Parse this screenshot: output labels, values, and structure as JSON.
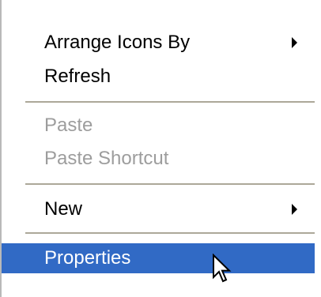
{
  "menu": {
    "items": [
      {
        "label": "Arrange Icons By",
        "has_submenu": true
      },
      {
        "label": "Refresh",
        "has_submenu": false
      },
      {
        "label": "Paste",
        "disabled": true
      },
      {
        "label": "Paste Shortcut",
        "disabled": true
      },
      {
        "label": "New",
        "has_submenu": true
      },
      {
        "label": "Properties",
        "highlighted": true
      }
    ]
  },
  "colors": {
    "highlight": "#316ac5",
    "disabled_text": "#9d9d9d",
    "separator": "#aca899"
  },
  "cursor": {
    "icon": "arrow-pointer-icon"
  }
}
